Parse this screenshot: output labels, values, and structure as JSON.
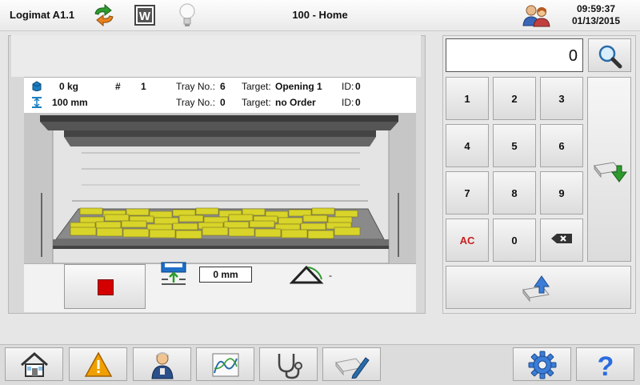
{
  "header": {
    "app_title": "Logimat A1.1",
    "screen_title": "100 - Home",
    "time": "09:59:37",
    "date": "01/13/2015",
    "icons": [
      "sync-arrows-icon",
      "w-mode-icon",
      "lightbulb-icon",
      "users-icon"
    ]
  },
  "info": {
    "weight": "0 kg",
    "hash_label": "#",
    "hash_value": "1",
    "height": "100 mm",
    "row1": {
      "tray_label": "Tray No.:",
      "tray_value": "6",
      "target_label": "Target:",
      "target_value": "Opening 1",
      "id_label": "ID:",
      "id_value": "0"
    },
    "row2": {
      "tray_label": "Tray No.:",
      "tray_value": "0",
      "target_label": "Target:",
      "target_value": "no Order",
      "id_label": "ID:",
      "id_value": "0"
    }
  },
  "controls": {
    "height_value": "0 mm",
    "angle_value": "-"
  },
  "keypad": {
    "display_value": "0",
    "keys": [
      "1",
      "2",
      "3",
      "4",
      "5",
      "6",
      "7",
      "8",
      "9",
      "AC",
      "0"
    ]
  },
  "bottom_nav": [
    "home-icon",
    "warning-icon",
    "operator-icon",
    "chart-icon",
    "stethoscope-icon",
    "tray-edit-icon",
    "settings-gear-icon",
    "help-icon"
  ],
  "colors": {
    "accent_warning": "#f0a000",
    "stop_red": "#d40000",
    "ac_red": "#c81e1e",
    "tray_items": "#d8d42a"
  }
}
